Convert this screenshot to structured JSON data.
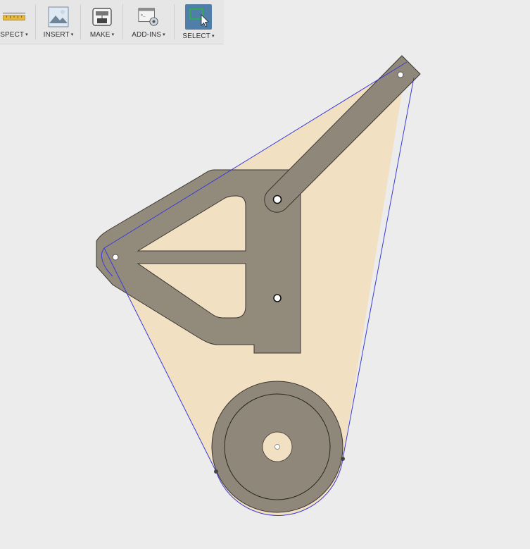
{
  "toolbar": {
    "items": [
      {
        "label": "SPECT",
        "icon": "inspect-ruler-icon"
      },
      {
        "label": "INSERT",
        "icon": "insert-image-icon"
      },
      {
        "label": "MAKE",
        "icon": "make-3d-print-icon"
      },
      {
        "label": "ADD-INS",
        "icon": "add-ins-script-icon"
      },
      {
        "label": "SELECT",
        "icon": "select-window-icon"
      }
    ],
    "caret": "▾"
  },
  "colors": {
    "background": "#ececec",
    "sketch_fill": "#f2e0c3",
    "body_fill": "#928a7b",
    "body_stroke": "#3a3630",
    "tangent_line": "#3b3bd6",
    "select_active": "#4f7fa8"
  }
}
